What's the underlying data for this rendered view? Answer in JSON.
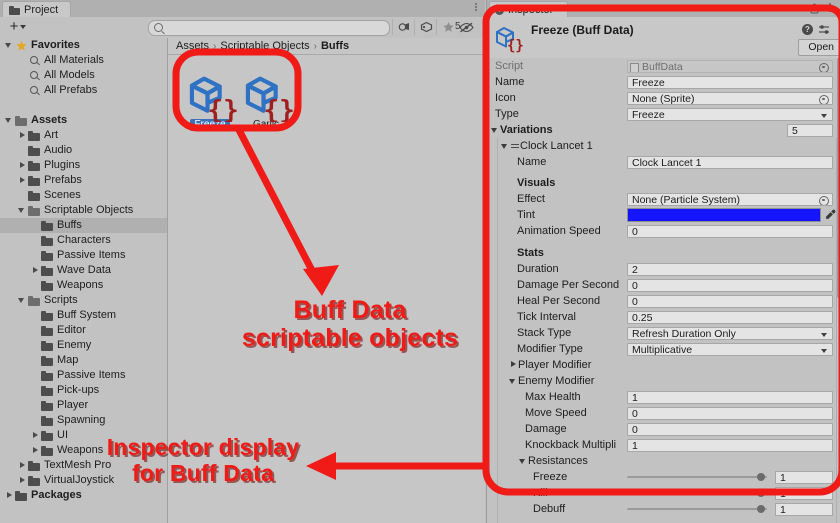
{
  "project_panel": {
    "tab": {
      "label": "Project",
      "icon": "folder-icon"
    },
    "toolbar": {
      "add_label": "+",
      "search_placeholder": "",
      "search_value": "",
      "hidden_count": "5",
      "icons": [
        "object-filter-icon",
        "label-filter-icon",
        "favorite-star-icon",
        "eye-slash-icon"
      ]
    },
    "tree": [
      {
        "label": "Favorites",
        "depth": 0,
        "arrow": "open",
        "icon": "star-icon",
        "bold": true,
        "selected": false
      },
      {
        "label": "All Materials",
        "depth": 1,
        "arrow": "none",
        "icon": "search-icon",
        "bold": false,
        "selected": false
      },
      {
        "label": "All Models",
        "depth": 1,
        "arrow": "none",
        "icon": "search-icon",
        "bold": false,
        "selected": false
      },
      {
        "label": "All Prefabs",
        "depth": 1,
        "arrow": "none",
        "icon": "search-icon",
        "bold": false,
        "selected": false
      },
      {
        "label": "",
        "depth": 0,
        "arrow": "none",
        "icon": "none",
        "bold": false,
        "selected": false
      },
      {
        "label": "Assets",
        "depth": 0,
        "arrow": "open",
        "icon": "folder-open-icon",
        "bold": true,
        "selected": false
      },
      {
        "label": "Art",
        "depth": 1,
        "arrow": "closed",
        "icon": "folder-icon",
        "bold": false,
        "selected": false
      },
      {
        "label": "Audio",
        "depth": 1,
        "arrow": "none",
        "icon": "folder-icon",
        "bold": false,
        "selected": false
      },
      {
        "label": "Plugins",
        "depth": 1,
        "arrow": "closed",
        "icon": "folder-icon",
        "bold": false,
        "selected": false
      },
      {
        "label": "Prefabs",
        "depth": 1,
        "arrow": "closed",
        "icon": "folder-icon",
        "bold": false,
        "selected": false
      },
      {
        "label": "Scenes",
        "depth": 1,
        "arrow": "none",
        "icon": "folder-icon",
        "bold": false,
        "selected": false
      },
      {
        "label": "Scriptable Objects",
        "depth": 1,
        "arrow": "open",
        "icon": "folder-open-icon",
        "bold": false,
        "selected": false
      },
      {
        "label": "Buffs",
        "depth": 2,
        "arrow": "none",
        "icon": "folder-icon",
        "bold": false,
        "selected": true
      },
      {
        "label": "Characters",
        "depth": 2,
        "arrow": "none",
        "icon": "folder-icon",
        "bold": false,
        "selected": false
      },
      {
        "label": "Passive Items",
        "depth": 2,
        "arrow": "none",
        "icon": "folder-icon",
        "bold": false,
        "selected": false
      },
      {
        "label": "Wave Data",
        "depth": 2,
        "arrow": "closed",
        "icon": "folder-icon",
        "bold": false,
        "selected": false
      },
      {
        "label": "Weapons",
        "depth": 2,
        "arrow": "none",
        "icon": "folder-icon",
        "bold": false,
        "selected": false
      },
      {
        "label": "Scripts",
        "depth": 1,
        "arrow": "open",
        "icon": "folder-open-icon",
        "bold": false,
        "selected": false
      },
      {
        "label": "Buff System",
        "depth": 2,
        "arrow": "none",
        "icon": "folder-icon",
        "bold": false,
        "selected": false
      },
      {
        "label": "Editor",
        "depth": 2,
        "arrow": "none",
        "icon": "folder-icon",
        "bold": false,
        "selected": false
      },
      {
        "label": "Enemy",
        "depth": 2,
        "arrow": "none",
        "icon": "folder-icon",
        "bold": false,
        "selected": false
      },
      {
        "label": "Map",
        "depth": 2,
        "arrow": "none",
        "icon": "folder-icon",
        "bold": false,
        "selected": false
      },
      {
        "label": "Passive Items",
        "depth": 2,
        "arrow": "none",
        "icon": "folder-icon",
        "bold": false,
        "selected": false
      },
      {
        "label": "Pick-ups",
        "depth": 2,
        "arrow": "none",
        "icon": "folder-icon",
        "bold": false,
        "selected": false
      },
      {
        "label": "Player",
        "depth": 2,
        "arrow": "none",
        "icon": "folder-icon",
        "bold": false,
        "selected": false
      },
      {
        "label": "Spawning",
        "depth": 2,
        "arrow": "none",
        "icon": "folder-icon",
        "bold": false,
        "selected": false
      },
      {
        "label": "UI",
        "depth": 2,
        "arrow": "closed",
        "icon": "folder-icon",
        "bold": false,
        "selected": false
      },
      {
        "label": "Weapons",
        "depth": 2,
        "arrow": "closed",
        "icon": "folder-icon",
        "bold": false,
        "selected": false
      },
      {
        "label": "TextMesh Pro",
        "depth": 1,
        "arrow": "closed",
        "icon": "folder-icon",
        "bold": false,
        "selected": false
      },
      {
        "label": "VirtualJoystick",
        "depth": 1,
        "arrow": "closed",
        "icon": "folder-icon",
        "bold": false,
        "selected": false
      },
      {
        "label": "Packages",
        "depth": 0,
        "arrow": "closed",
        "icon": "folder-icon",
        "bold": true,
        "selected": false
      }
    ],
    "breadcrumb": [
      "Assets",
      "Scriptable Objects",
      "Buffs"
    ],
    "assets": [
      {
        "name": "Freeze",
        "icon": "scriptable-object-icon",
        "selected": true
      },
      {
        "name": "Garlic",
        "icon": "scriptable-object-icon",
        "selected": false
      }
    ]
  },
  "inspector": {
    "tab": {
      "label": "Inspector",
      "icon": "info-icon"
    },
    "header": {
      "title": "Freeze (Buff Data)",
      "icon": "scriptable-object-icon",
      "open_button": "Open"
    },
    "fields": {
      "script_label": "Script",
      "script_value": "BuffData",
      "name_label": "Name",
      "name_value": "Freeze",
      "icon_label": "Icon",
      "icon_value": "None (Sprite)",
      "type_label": "Type",
      "type_value": "Freeze",
      "variations_label": "Variations",
      "variations_count": "5"
    },
    "variation": {
      "header": "Clock Lancet 1",
      "name_label": "Name",
      "name_value": "Clock Lancet 1",
      "visuals_header": "Visuals",
      "effect_label": "Effect",
      "effect_value": "None (Particle System)",
      "tint_label": "Tint",
      "tint_color": "#1414ff",
      "anim_speed_label": "Animation Speed",
      "anim_speed_value": "0",
      "stats_header": "Stats",
      "stats": [
        {
          "label": "Duration",
          "value": "2",
          "kind": "text"
        },
        {
          "label": "Damage Per Second",
          "value": "0",
          "kind": "text"
        },
        {
          "label": "Heal Per Second",
          "value": "0",
          "kind": "text"
        },
        {
          "label": "Tick Interval",
          "value": "0.25",
          "kind": "text"
        },
        {
          "label": "Stack Type",
          "value": "Refresh Duration Only",
          "kind": "dropdown"
        },
        {
          "label": "Modifier Type",
          "value": "Multiplicative",
          "kind": "dropdown"
        }
      ],
      "player_modifier_label": "Player Modifier",
      "enemy_modifier_label": "Enemy Modifier",
      "enemy_modifier": [
        {
          "label": "Max Health",
          "value": "1"
        },
        {
          "label": "Move Speed",
          "value": "0"
        },
        {
          "label": "Damage",
          "value": "0"
        },
        {
          "label": "Knockback Multipli",
          "value": "1"
        }
      ],
      "resistances_label": "Resistances",
      "resistances": [
        {
          "label": "Freeze",
          "value": "1"
        },
        {
          "label": "Kill",
          "value": "1"
        },
        {
          "label": "Debuff",
          "value": "1"
        }
      ]
    }
  },
  "annotations": {
    "callout_assets": "Buff Data\nscriptable objects",
    "callout_assets_line1": "Buff Data",
    "callout_assets_line2": "scriptable objects",
    "callout_inspector_line1": "Inspector display",
    "callout_inspector_line2": "for Buff Data",
    "color": "#f01a16"
  }
}
